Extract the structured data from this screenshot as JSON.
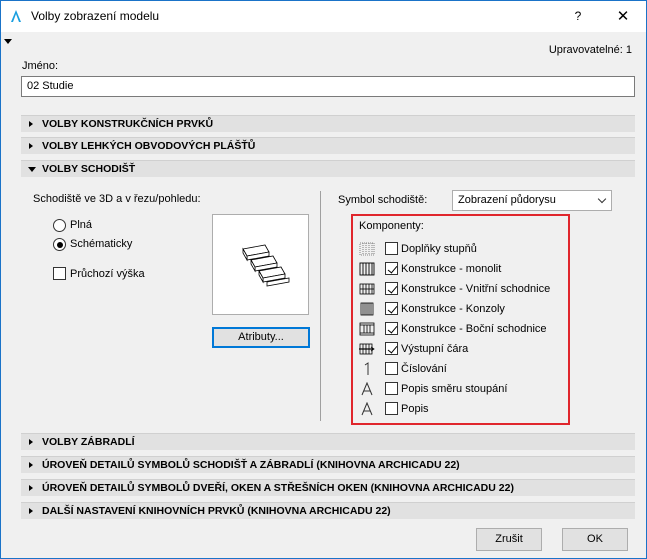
{
  "window": {
    "title": "Volby zobrazení modelu",
    "help": "?",
    "close": "✕"
  },
  "editable": "Upravovatelné: 1",
  "name": {
    "label": "Jméno:",
    "value": "02 Studie"
  },
  "sections": {
    "construction": "VOLBY KONSTRUKČNÍCH PRVKŮ",
    "curtain": "VOLBY LEHKÝCH OBVODOVÝCH PLÁŠŤŮ",
    "stairs": "VOLBY SCHODIŠŤ",
    "railing": "VOLBY ZÁBRADLÍ",
    "detail_stairs": "ÚROVEŇ DETAILŮ SYMBOLŮ SCHODIŠŤ A ZÁBRADLÍ (KNIHOVNA ARCHICADU 22)",
    "detail_doors": "ÚROVEŇ DETAILŮ SYMBOLŮ DVEŘÍ, OKEN A STŘEŠNÍCH OKEN (KNIHOVNA ARCHICADU 22)",
    "library": "DALŠÍ NASTAVENÍ KNIHOVNÍCH PRVKŮ (KNIHOVNA ARCHICADU 22)"
  },
  "stairs": {
    "view_label": "Schodiště ve 3D a v řezu/pohledu:",
    "radio_solid": "Plná",
    "radio_schematic": "Schématicky",
    "headroom": "Průchozí výška",
    "attributes_button": "Atributy...",
    "symbol_label": "Symbol schodiště:",
    "symbol_value": "Zobrazení půdorysu",
    "components_label": "Komponenty:",
    "components": [
      {
        "label": "Doplňky stupňů",
        "checked": false
      },
      {
        "label": "Konstrukce - monolit",
        "checked": true
      },
      {
        "label": "Konstrukce - Vnitřní schodnice",
        "checked": true
      },
      {
        "label": "Konstrukce - Konzoly",
        "checked": true
      },
      {
        "label": "Konstrukce - Boční schodnice",
        "checked": true
      },
      {
        "label": "Výstupní čára",
        "checked": true
      },
      {
        "label": "Číslování",
        "checked": false
      },
      {
        "label": "Popis směru stoupání",
        "checked": false
      },
      {
        "label": "Popis",
        "checked": false
      }
    ]
  },
  "footer": {
    "cancel": "Zrušit",
    "ok": "OK"
  }
}
